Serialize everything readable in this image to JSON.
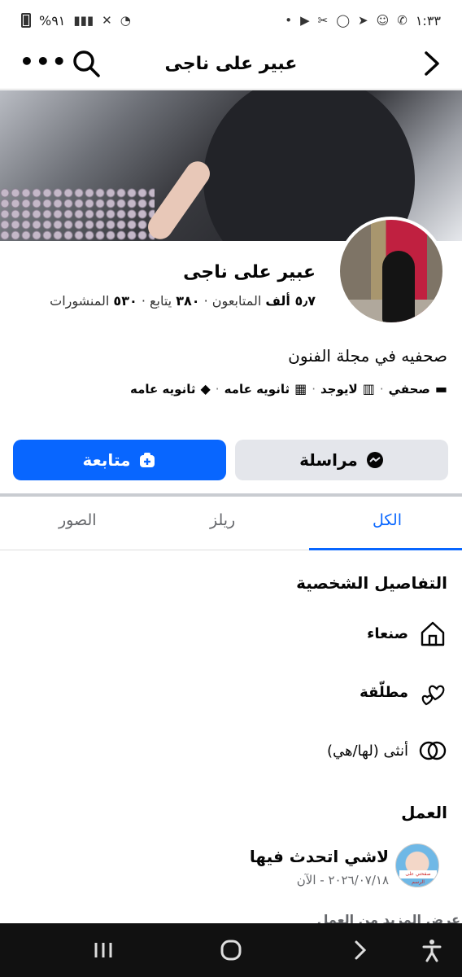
{
  "status_bar": {
    "battery": "%٩١",
    "time": "١:٣٣"
  },
  "header": {
    "title": "عبير على ناجى"
  },
  "profile": {
    "name": "عبير على ناجى",
    "followers_count": "٥٫٧ ألف",
    "followers_label": "المتابعون",
    "following_count": "٣٨٠",
    "following_label": "يتابع",
    "posts_count": "٥٣٠",
    "posts_label": "المنشورات",
    "bio": "صحفيه في مجلة الفنون",
    "details": [
      "صحفي",
      "لايوجد",
      "ثانويه عامه",
      "ثانويه عامه"
    ]
  },
  "buttons": {
    "message": "مراسلة",
    "follow": "متابعة"
  },
  "tabs": {
    "all": "الكل",
    "reels": "ريلز",
    "photos": "الصور"
  },
  "personal": {
    "title": "التفاصيل الشخصية",
    "city": "صنعاء",
    "relationship": "مطلّقة",
    "gender": "أنثى (لها/هي)"
  },
  "work": {
    "title": "العمل",
    "name": "لاشي اتحدث فيها",
    "date": "٢٠٢٦/٠٧/١٨ - الآن",
    "logo_text": "صفحتي على الرسم",
    "more": "عرض المزيد من العمل"
  },
  "colors": {
    "accent": "#0866ff",
    "secondary_button": "#e4e6eb"
  }
}
